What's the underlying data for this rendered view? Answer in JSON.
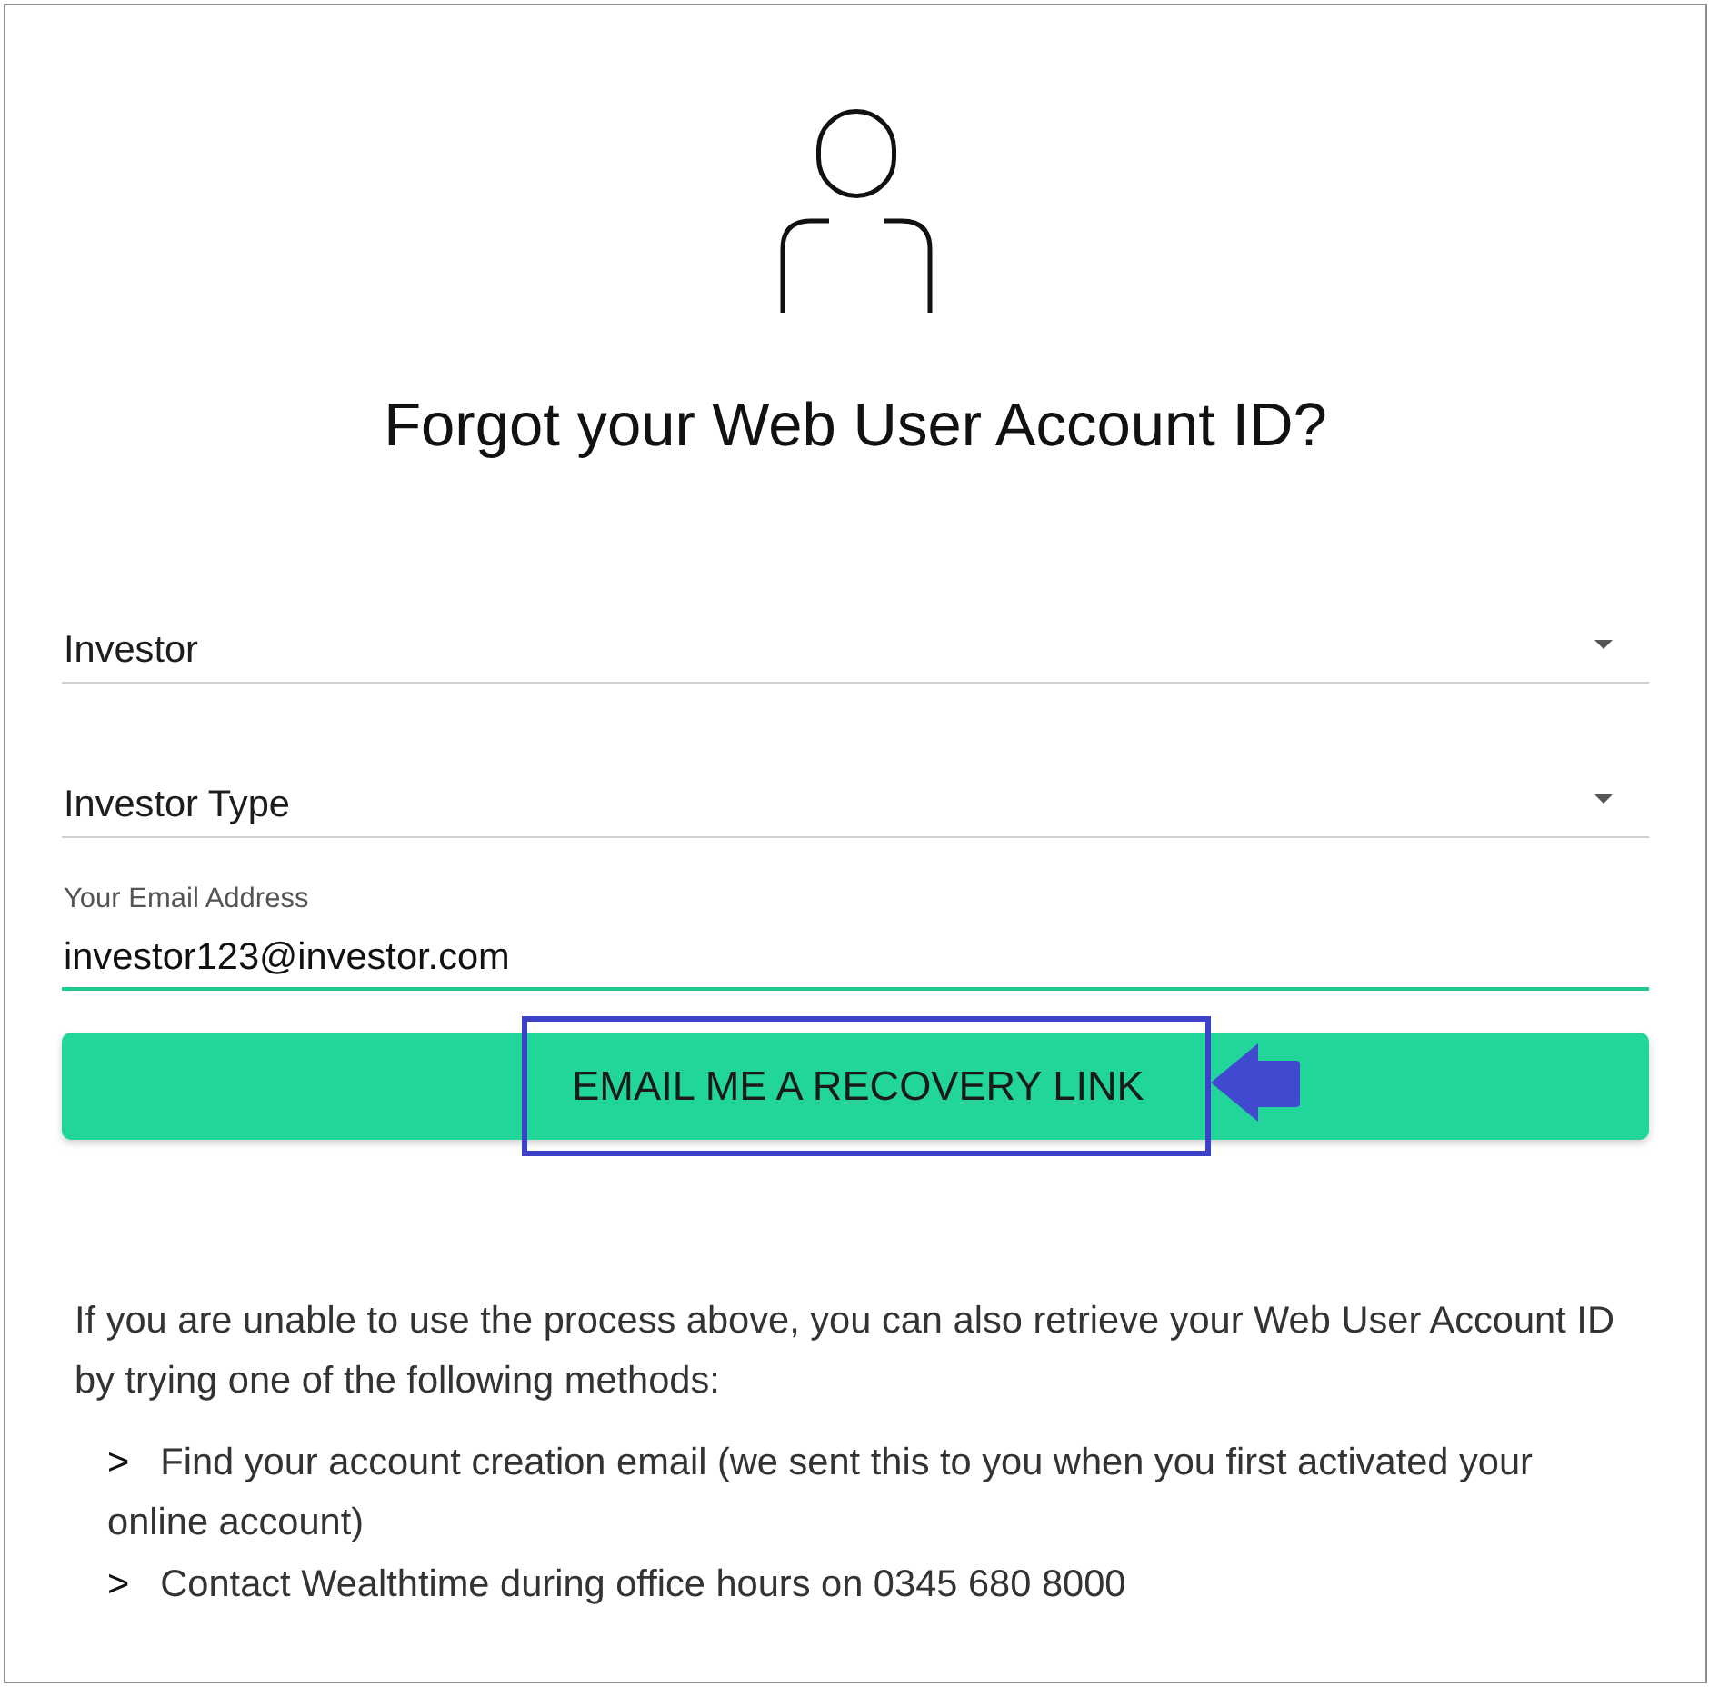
{
  "header": {
    "title": "Forgot your Web User Account ID?"
  },
  "form": {
    "fields": [
      {
        "kind": "select",
        "value": "Investor",
        "focused": false
      },
      {
        "kind": "select",
        "value": "Investor Type",
        "focused": false
      },
      {
        "kind": "input",
        "label": "Your Email Address",
        "value": "investor123@investor.com",
        "focused": true
      }
    ],
    "submit": {
      "label": "EMAIL ME A RECOVERY LINK",
      "highlighted": true
    }
  },
  "help": {
    "text": "If you are unable to use the process above, you can also retrieve your Web User Account ID by trying one of the following methods:",
    "methods": [
      {
        "marker": ">",
        "text": "Find your account creation email (we sent this to you when you first activated your online account)"
      },
      {
        "marker": ">",
        "text": "Contact Wealthtime during office hours on 0345 680 8000"
      }
    ]
  }
}
